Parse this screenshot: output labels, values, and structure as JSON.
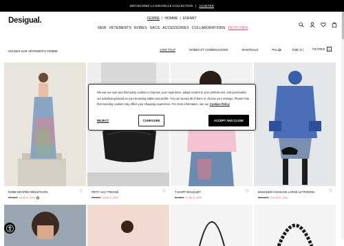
{
  "promo": {
    "text": "DÉCOUVREZ LA NOUVELLE COLLECTION",
    "sep": "|",
    "link": "ACHETER"
  },
  "header": {
    "logo": "Desigual.",
    "gender": [
      "FEMME",
      "|",
      "HOMME",
      "|",
      "ENFANT"
    ],
    "nav": [
      "NEW",
      "VÊTEMENTS",
      "ROBES",
      "SACS",
      "ACCESSOIRES",
      "COLLABORATIONS",
      "PETIT PRIX"
    ]
  },
  "subbar": {
    "crumb": "SOLDES SUR VÊTEMENTS FEMME",
    "filters": [
      "VOIR TOUT",
      "ROBES ET COMBINAISONS",
      "MANTEAUX",
      "PULLS",
      "BAS"
    ],
    "view": "VUE: 4 |",
    "filter_label": "FILTRES",
    "filter_count": "0"
  },
  "products": [
    {
      "name": "ROBE DRAPÉE NÉNUPHARS",
      "old": "79,95 €",
      "new": "55,95 € -30%"
    },
    {
      "name": "PETIT SAC TRESSÉ",
      "old": "79,95 €",
      "new": "55,95 € -30%"
    },
    {
      "name": "T-SHIRT BOUQUET",
      "old": "39,95 €",
      "new": "27,95 € -30%"
    },
    {
      "name": "BUDADERA MANCHE LARGE LETTERING",
      "old": "339,95 €",
      "new": "209,95 € -30%"
    }
  ],
  "consent": {
    "text": "We use our own and third-party cookies to improve your experience, adapt content to your preferences, and personalise our advertising based on your browsing habits and profile. You can accept all of them or choose your settings. Please note that rejecting cookies may affect your shopping experience. For more information, see our",
    "link": "Cookies Policy",
    "reject": "REJECT",
    "configure": "CONFIGURE",
    "accept": "ACCEPT AND CLOSE"
  }
}
